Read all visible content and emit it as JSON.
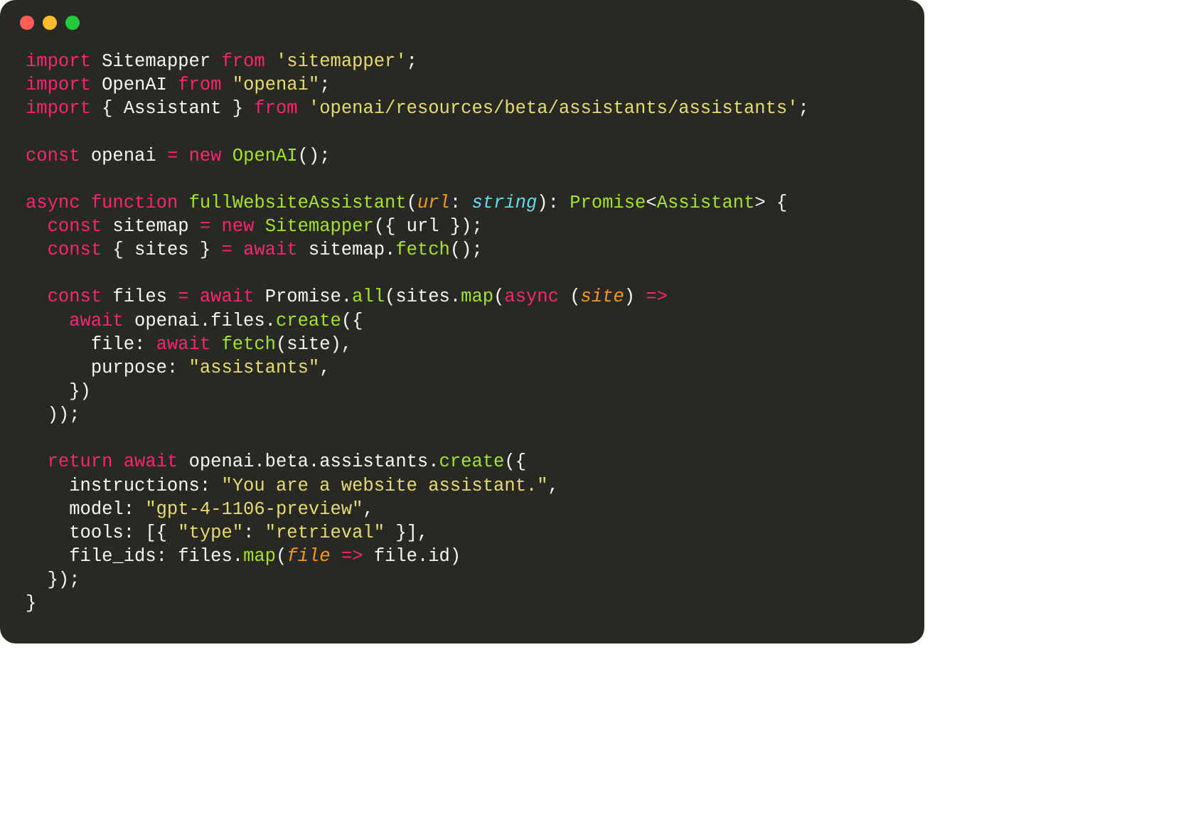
{
  "colors": {
    "background": "#282923",
    "foreground": "#f8f8f2",
    "keyword": "#f92672",
    "function": "#a6e22e",
    "string": "#e6db74",
    "type": "#66d9ef",
    "param": "#fd971f",
    "traffic_red": "#ff5f56",
    "traffic_yellow": "#ffbd2e",
    "traffic_green": "#27c93f"
  },
  "code_lines": [
    [
      {
        "c": "t-kw",
        "t": "import"
      },
      {
        "c": "t-plain",
        "t": " Sitemapper "
      },
      {
        "c": "t-kw",
        "t": "from"
      },
      {
        "c": "t-plain",
        "t": " "
      },
      {
        "c": "t-str",
        "t": "'sitemapper'"
      },
      {
        "c": "t-plain",
        "t": ";"
      }
    ],
    [
      {
        "c": "t-kw",
        "t": "import"
      },
      {
        "c": "t-plain",
        "t": " OpenAI "
      },
      {
        "c": "t-kw",
        "t": "from"
      },
      {
        "c": "t-plain",
        "t": " "
      },
      {
        "c": "t-str",
        "t": "\"openai\""
      },
      {
        "c": "t-plain",
        "t": ";"
      }
    ],
    [
      {
        "c": "t-kw",
        "t": "import"
      },
      {
        "c": "t-plain",
        "t": " { Assistant } "
      },
      {
        "c": "t-kw",
        "t": "from"
      },
      {
        "c": "t-plain",
        "t": " "
      },
      {
        "c": "t-str",
        "t": "'openai/resources/beta/assistants/assistants'"
      },
      {
        "c": "t-plain",
        "t": ";"
      }
    ],
    [],
    [
      {
        "c": "t-kw",
        "t": "const"
      },
      {
        "c": "t-plain",
        "t": " openai "
      },
      {
        "c": "t-kw",
        "t": "="
      },
      {
        "c": "t-plain",
        "t": " "
      },
      {
        "c": "t-kw",
        "t": "new"
      },
      {
        "c": "t-plain",
        "t": " "
      },
      {
        "c": "t-fn",
        "t": "OpenAI"
      },
      {
        "c": "t-plain",
        "t": "();"
      }
    ],
    [],
    [
      {
        "c": "t-kw",
        "t": "async"
      },
      {
        "c": "t-plain",
        "t": " "
      },
      {
        "c": "t-kw",
        "t": "function"
      },
      {
        "c": "t-plain",
        "t": " "
      },
      {
        "c": "t-fn",
        "t": "fullWebsiteAssistant"
      },
      {
        "c": "t-plain",
        "t": "("
      },
      {
        "c": "t-param",
        "t": "url"
      },
      {
        "c": "t-plain",
        "t": ": "
      },
      {
        "c": "t-type",
        "t": "string"
      },
      {
        "c": "t-plain",
        "t": "): "
      },
      {
        "c": "t-fn",
        "t": "Promise"
      },
      {
        "c": "t-plain",
        "t": "<"
      },
      {
        "c": "t-fn",
        "t": "Assistant"
      },
      {
        "c": "t-plain",
        "t": "> {"
      }
    ],
    [
      {
        "c": "t-plain",
        "t": "  "
      },
      {
        "c": "t-kw",
        "t": "const"
      },
      {
        "c": "t-plain",
        "t": " sitemap "
      },
      {
        "c": "t-kw",
        "t": "="
      },
      {
        "c": "t-plain",
        "t": " "
      },
      {
        "c": "t-kw",
        "t": "new"
      },
      {
        "c": "t-plain",
        "t": " "
      },
      {
        "c": "t-fn",
        "t": "Sitemapper"
      },
      {
        "c": "t-plain",
        "t": "({ url });"
      }
    ],
    [
      {
        "c": "t-plain",
        "t": "  "
      },
      {
        "c": "t-kw",
        "t": "const"
      },
      {
        "c": "t-plain",
        "t": " { sites } "
      },
      {
        "c": "t-kw",
        "t": "="
      },
      {
        "c": "t-plain",
        "t": " "
      },
      {
        "c": "t-kw",
        "t": "await"
      },
      {
        "c": "t-plain",
        "t": " sitemap."
      },
      {
        "c": "t-fn",
        "t": "fetch"
      },
      {
        "c": "t-plain",
        "t": "();"
      }
    ],
    [],
    [
      {
        "c": "t-plain",
        "t": "  "
      },
      {
        "c": "t-kw",
        "t": "const"
      },
      {
        "c": "t-plain",
        "t": " files "
      },
      {
        "c": "t-kw",
        "t": "="
      },
      {
        "c": "t-plain",
        "t": " "
      },
      {
        "c": "t-kw",
        "t": "await"
      },
      {
        "c": "t-plain",
        "t": " Promise."
      },
      {
        "c": "t-fn",
        "t": "all"
      },
      {
        "c": "t-plain",
        "t": "(sites."
      },
      {
        "c": "t-fn",
        "t": "map"
      },
      {
        "c": "t-plain",
        "t": "("
      },
      {
        "c": "t-kw",
        "t": "async"
      },
      {
        "c": "t-plain",
        "t": " ("
      },
      {
        "c": "t-param",
        "t": "site"
      },
      {
        "c": "t-plain",
        "t": ") "
      },
      {
        "c": "t-kw",
        "t": "=>"
      }
    ],
    [
      {
        "c": "t-plain",
        "t": "    "
      },
      {
        "c": "t-kw",
        "t": "await"
      },
      {
        "c": "t-plain",
        "t": " openai.files."
      },
      {
        "c": "t-fn",
        "t": "create"
      },
      {
        "c": "t-plain",
        "t": "({"
      }
    ],
    [
      {
        "c": "t-plain",
        "t": "      file: "
      },
      {
        "c": "t-kw",
        "t": "await"
      },
      {
        "c": "t-plain",
        "t": " "
      },
      {
        "c": "t-fn",
        "t": "fetch"
      },
      {
        "c": "t-plain",
        "t": "(site),"
      }
    ],
    [
      {
        "c": "t-plain",
        "t": "      purpose: "
      },
      {
        "c": "t-str",
        "t": "\"assistants\""
      },
      {
        "c": "t-plain",
        "t": ","
      }
    ],
    [
      {
        "c": "t-plain",
        "t": "    })"
      }
    ],
    [
      {
        "c": "t-plain",
        "t": "  ));"
      }
    ],
    [],
    [
      {
        "c": "t-plain",
        "t": "  "
      },
      {
        "c": "t-kw",
        "t": "return"
      },
      {
        "c": "t-plain",
        "t": " "
      },
      {
        "c": "t-kw",
        "t": "await"
      },
      {
        "c": "t-plain",
        "t": " openai.beta.assistants."
      },
      {
        "c": "t-fn",
        "t": "create"
      },
      {
        "c": "t-plain",
        "t": "({"
      }
    ],
    [
      {
        "c": "t-plain",
        "t": "    instructions: "
      },
      {
        "c": "t-str",
        "t": "\"You are a website assistant.\""
      },
      {
        "c": "t-plain",
        "t": ","
      }
    ],
    [
      {
        "c": "t-plain",
        "t": "    model: "
      },
      {
        "c": "t-str",
        "t": "\"gpt-4-1106-preview\""
      },
      {
        "c": "t-plain",
        "t": ","
      }
    ],
    [
      {
        "c": "t-plain",
        "t": "    tools: [{ "
      },
      {
        "c": "t-str",
        "t": "\"type\""
      },
      {
        "c": "t-plain",
        "t": ": "
      },
      {
        "c": "t-str",
        "t": "\"retrieval\""
      },
      {
        "c": "t-plain",
        "t": " }],"
      }
    ],
    [
      {
        "c": "t-plain",
        "t": "    file_ids: files."
      },
      {
        "c": "t-fn",
        "t": "map"
      },
      {
        "c": "t-plain",
        "t": "("
      },
      {
        "c": "t-param",
        "t": "file"
      },
      {
        "c": "t-plain",
        "t": " "
      },
      {
        "c": "t-kw",
        "t": "=>"
      },
      {
        "c": "t-plain",
        "t": " file.id)"
      }
    ],
    [
      {
        "c": "t-plain",
        "t": "  });"
      }
    ],
    [
      {
        "c": "t-plain",
        "t": "}"
      }
    ]
  ]
}
